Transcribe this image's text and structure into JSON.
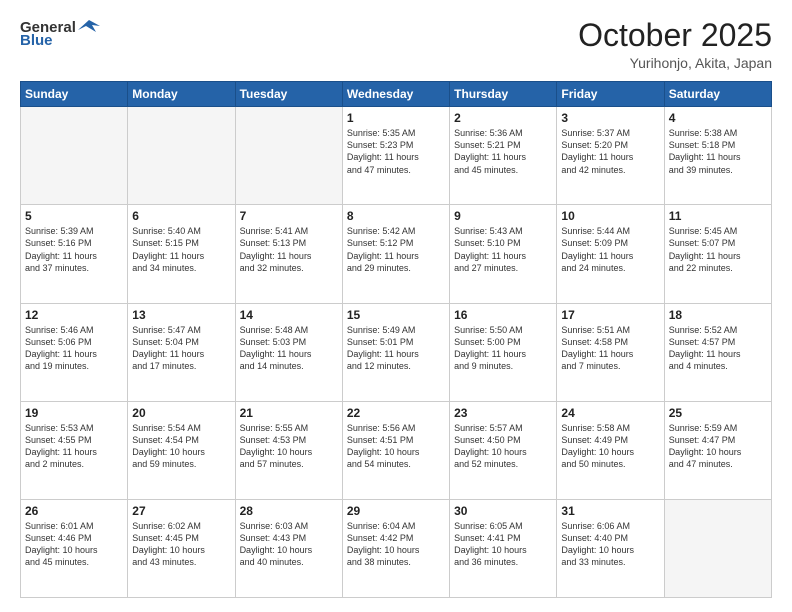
{
  "header": {
    "logo_general": "General",
    "logo_blue": "Blue",
    "month": "October 2025",
    "location": "Yurihonjo, Akita, Japan"
  },
  "weekdays": [
    "Sunday",
    "Monday",
    "Tuesday",
    "Wednesday",
    "Thursday",
    "Friday",
    "Saturday"
  ],
  "weeks": [
    [
      {
        "day": "",
        "text": "",
        "empty": true
      },
      {
        "day": "",
        "text": "",
        "empty": true
      },
      {
        "day": "",
        "text": "",
        "empty": true
      },
      {
        "day": "1",
        "text": "Sunrise: 5:35 AM\nSunset: 5:23 PM\nDaylight: 11 hours\nand 47 minutes."
      },
      {
        "day": "2",
        "text": "Sunrise: 5:36 AM\nSunset: 5:21 PM\nDaylight: 11 hours\nand 45 minutes."
      },
      {
        "day": "3",
        "text": "Sunrise: 5:37 AM\nSunset: 5:20 PM\nDaylight: 11 hours\nand 42 minutes."
      },
      {
        "day": "4",
        "text": "Sunrise: 5:38 AM\nSunset: 5:18 PM\nDaylight: 11 hours\nand 39 minutes."
      }
    ],
    [
      {
        "day": "5",
        "text": "Sunrise: 5:39 AM\nSunset: 5:16 PM\nDaylight: 11 hours\nand 37 minutes."
      },
      {
        "day": "6",
        "text": "Sunrise: 5:40 AM\nSunset: 5:15 PM\nDaylight: 11 hours\nand 34 minutes."
      },
      {
        "day": "7",
        "text": "Sunrise: 5:41 AM\nSunset: 5:13 PM\nDaylight: 11 hours\nand 32 minutes."
      },
      {
        "day": "8",
        "text": "Sunrise: 5:42 AM\nSunset: 5:12 PM\nDaylight: 11 hours\nand 29 minutes."
      },
      {
        "day": "9",
        "text": "Sunrise: 5:43 AM\nSunset: 5:10 PM\nDaylight: 11 hours\nand 27 minutes."
      },
      {
        "day": "10",
        "text": "Sunrise: 5:44 AM\nSunset: 5:09 PM\nDaylight: 11 hours\nand 24 minutes."
      },
      {
        "day": "11",
        "text": "Sunrise: 5:45 AM\nSunset: 5:07 PM\nDaylight: 11 hours\nand 22 minutes."
      }
    ],
    [
      {
        "day": "12",
        "text": "Sunrise: 5:46 AM\nSunset: 5:06 PM\nDaylight: 11 hours\nand 19 minutes."
      },
      {
        "day": "13",
        "text": "Sunrise: 5:47 AM\nSunset: 5:04 PM\nDaylight: 11 hours\nand 17 minutes."
      },
      {
        "day": "14",
        "text": "Sunrise: 5:48 AM\nSunset: 5:03 PM\nDaylight: 11 hours\nand 14 minutes."
      },
      {
        "day": "15",
        "text": "Sunrise: 5:49 AM\nSunset: 5:01 PM\nDaylight: 11 hours\nand 12 minutes."
      },
      {
        "day": "16",
        "text": "Sunrise: 5:50 AM\nSunset: 5:00 PM\nDaylight: 11 hours\nand 9 minutes."
      },
      {
        "day": "17",
        "text": "Sunrise: 5:51 AM\nSunset: 4:58 PM\nDaylight: 11 hours\nand 7 minutes."
      },
      {
        "day": "18",
        "text": "Sunrise: 5:52 AM\nSunset: 4:57 PM\nDaylight: 11 hours\nand 4 minutes."
      }
    ],
    [
      {
        "day": "19",
        "text": "Sunrise: 5:53 AM\nSunset: 4:55 PM\nDaylight: 11 hours\nand 2 minutes."
      },
      {
        "day": "20",
        "text": "Sunrise: 5:54 AM\nSunset: 4:54 PM\nDaylight: 10 hours\nand 59 minutes."
      },
      {
        "day": "21",
        "text": "Sunrise: 5:55 AM\nSunset: 4:53 PM\nDaylight: 10 hours\nand 57 minutes."
      },
      {
        "day": "22",
        "text": "Sunrise: 5:56 AM\nSunset: 4:51 PM\nDaylight: 10 hours\nand 54 minutes."
      },
      {
        "day": "23",
        "text": "Sunrise: 5:57 AM\nSunset: 4:50 PM\nDaylight: 10 hours\nand 52 minutes."
      },
      {
        "day": "24",
        "text": "Sunrise: 5:58 AM\nSunset: 4:49 PM\nDaylight: 10 hours\nand 50 minutes."
      },
      {
        "day": "25",
        "text": "Sunrise: 5:59 AM\nSunset: 4:47 PM\nDaylight: 10 hours\nand 47 minutes."
      }
    ],
    [
      {
        "day": "26",
        "text": "Sunrise: 6:01 AM\nSunset: 4:46 PM\nDaylight: 10 hours\nand 45 minutes."
      },
      {
        "day": "27",
        "text": "Sunrise: 6:02 AM\nSunset: 4:45 PM\nDaylight: 10 hours\nand 43 minutes."
      },
      {
        "day": "28",
        "text": "Sunrise: 6:03 AM\nSunset: 4:43 PM\nDaylight: 10 hours\nand 40 minutes."
      },
      {
        "day": "29",
        "text": "Sunrise: 6:04 AM\nSunset: 4:42 PM\nDaylight: 10 hours\nand 38 minutes."
      },
      {
        "day": "30",
        "text": "Sunrise: 6:05 AM\nSunset: 4:41 PM\nDaylight: 10 hours\nand 36 minutes."
      },
      {
        "day": "31",
        "text": "Sunrise: 6:06 AM\nSunset: 4:40 PM\nDaylight: 10 hours\nand 33 minutes."
      },
      {
        "day": "",
        "text": "",
        "empty": true,
        "shaded": true
      }
    ]
  ]
}
